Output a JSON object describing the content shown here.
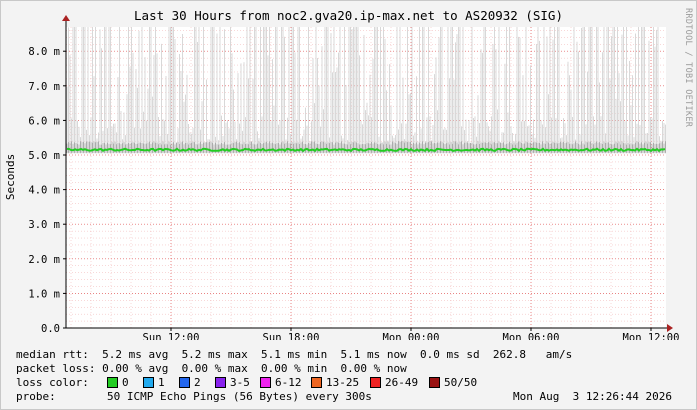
{
  "chart_data": {
    "type": "line",
    "title": "Last 30 Hours from noc2.gva20.ip-max.net to AS20932 (SIG)",
    "ylabel": "Seconds",
    "ylim": [
      0,
      0.0087
    ],
    "y_ticks": [
      {
        "value": 0,
        "label": "0.0"
      },
      {
        "value": 0.001,
        "label": "1.0 m"
      },
      {
        "value": 0.002,
        "label": "2.0 m"
      },
      {
        "value": 0.003,
        "label": "3.0 m"
      },
      {
        "value": 0.004,
        "label": "4.0 m"
      },
      {
        "value": 0.005,
        "label": "5.0 m"
      },
      {
        "value": 0.006,
        "label": "6.0 m"
      },
      {
        "value": 0.007,
        "label": "7.0 m"
      },
      {
        "value": 0.008,
        "label": "8.0 m"
      }
    ],
    "x_range_hours": [
      0,
      30
    ],
    "x_ticks": [
      {
        "hour": 5.25,
        "label": "Sun 12:00"
      },
      {
        "hour": 11.25,
        "label": "Sun 18:00"
      },
      {
        "hour": 17.25,
        "label": "Mon 00:00"
      },
      {
        "hour": 23.25,
        "label": "Mon 06:00"
      },
      {
        "hour": 29.25,
        "label": "Mon 12:00"
      }
    ],
    "median_rtt_ms": 5.15,
    "ping_spread_max_ms": 8.7,
    "grid": true,
    "colors": {
      "median_line": "#22cc22",
      "smoke": "#d8d8d8",
      "grid_minor": "#f0b0b0",
      "grid_major": "#e05050",
      "axis_arrow": "#aa2222",
      "background": "#ffffff"
    }
  },
  "side_credit": "RRDTOOL / TOBI OETIKER",
  "stats": {
    "median_rtt": "median rtt:  5.2 ms avg  5.2 ms max  5.1 ms min  5.1 ms now  0.0 ms sd  262.8   am/s",
    "packet_loss": "packet loss: 0.00 % avg  0.00 % max  0.00 % min  0.00 % now",
    "loss_color_label": "loss color:",
    "probe_label": "probe:",
    "probe_text": "50 ICMP Echo Pings (56 Bytes) every 300s",
    "timestamp": "Mon Aug  3 12:26:44 2026"
  },
  "loss_legend": [
    {
      "label": "0",
      "color": "#22cc22"
    },
    {
      "label": "1",
      "color": "#22aaee"
    },
    {
      "label": "2",
      "color": "#2266ee"
    },
    {
      "label": "3-5",
      "color": "#8822ee"
    },
    {
      "label": "6-12",
      "color": "#ee22ee"
    },
    {
      "label": "13-25",
      "color": "#ee6622"
    },
    {
      "label": "26-49",
      "color": "#ee2222"
    },
    {
      "label": "50/50",
      "color": "#991111"
    }
  ]
}
